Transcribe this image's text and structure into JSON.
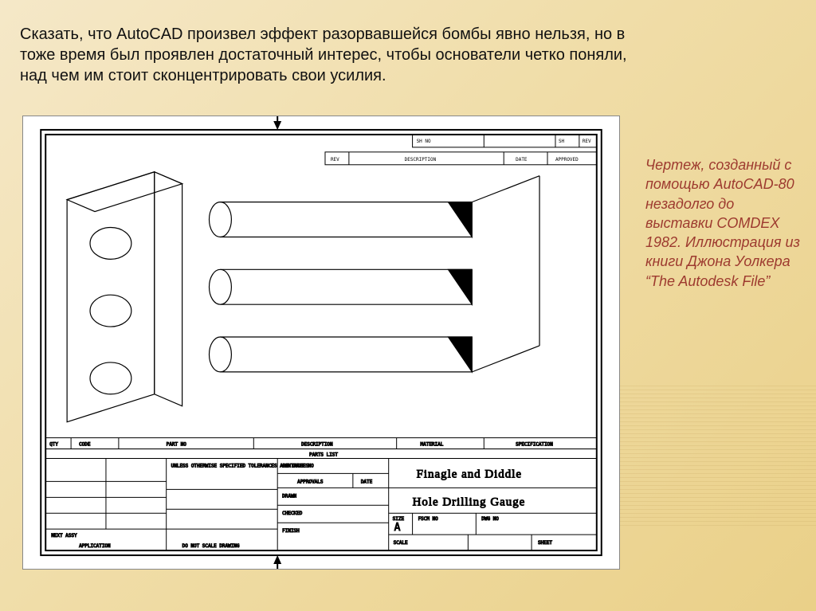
{
  "mainText": "Сказать, что AutoCAD произвел эффект разорвавшейся бомбы явно нельзя, но в тоже время был проявлен достаточный интерес, чтобы основатели четко поняли, над чем им стоит сконцентрировать свои усилия.",
  "caption": "Чертеж, созданный с помощью AutoCAD-80 незадолго до выставки COMDEX 1982. Иллюстрация из книги Джона Уолкера “The Autodesk File”",
  "titleBlock": {
    "topRow": {
      "sheetNo": "SH NO",
      "rev": "REV",
      "sh": "SH"
    },
    "revHeader": {
      "rev": "REV",
      "description": "DESCRIPTION",
      "date": "DATE",
      "approved": "APPROVED"
    },
    "bottomLeft": {
      "qty": "QTY",
      "code": "CODE",
      "partNo": "PART NO",
      "description": "DESCRIPTION",
      "material": "MATERIAL",
      "specification": "SPECIFICATION"
    },
    "partsList": "PARTS LIST",
    "tolerances": "UNLESS OTHERWISE SPECIFIED\nTOLERANCES ARE INCHES",
    "contractNo": "CONTRACT NO",
    "approvals": "APPROVALS",
    "date": "DATE",
    "drawn": "DRAWN",
    "checked": "CHECKED",
    "finish": "FINISH",
    "company1": "Finagle and Diddle",
    "company2": "Hole Drilling Gauge",
    "size": "SIZE",
    "sizeVal": "A",
    "fscmNo": "FSCM NO",
    "dwgNo": "DWG NO",
    "scale": "SCALE",
    "sheet": "SHEET",
    "nextAssy": "NEXT ASSY",
    "application": "APPLICATION",
    "doNotScale": "DO NOT SCALE DRAWING"
  }
}
